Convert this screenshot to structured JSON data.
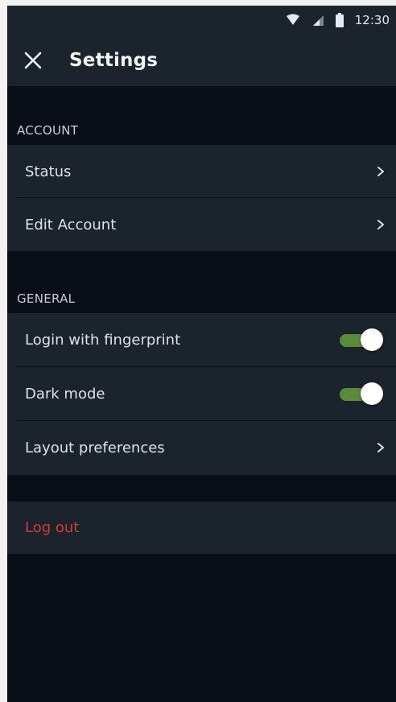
{
  "status_bar": {
    "time": "12:30",
    "icons": [
      "wifi-icon",
      "cell-signal-icon",
      "battery-icon"
    ]
  },
  "app_bar": {
    "title": "Settings",
    "close_icon": "close-icon"
  },
  "sections": {
    "account": {
      "header": "ACCOUNT",
      "items": [
        {
          "label": "Status",
          "trailing": "chevron-right-icon"
        },
        {
          "label": "Edit Account",
          "trailing": "chevron-right-icon"
        }
      ]
    },
    "general": {
      "header": "GENERAL",
      "items": [
        {
          "label": "Login with fingerprint",
          "toggle": true
        },
        {
          "label": "Dark mode",
          "toggle": true
        },
        {
          "label": "Layout preferences",
          "trailing": "chevron-right-icon"
        }
      ]
    }
  },
  "logout": {
    "label": "Log out"
  },
  "colors": {
    "background": "#0a0f17",
    "surface": "#1b232d",
    "text": "#dde2e7",
    "accent_toggle": "#5a8a3c",
    "danger": "#d23b3b"
  }
}
